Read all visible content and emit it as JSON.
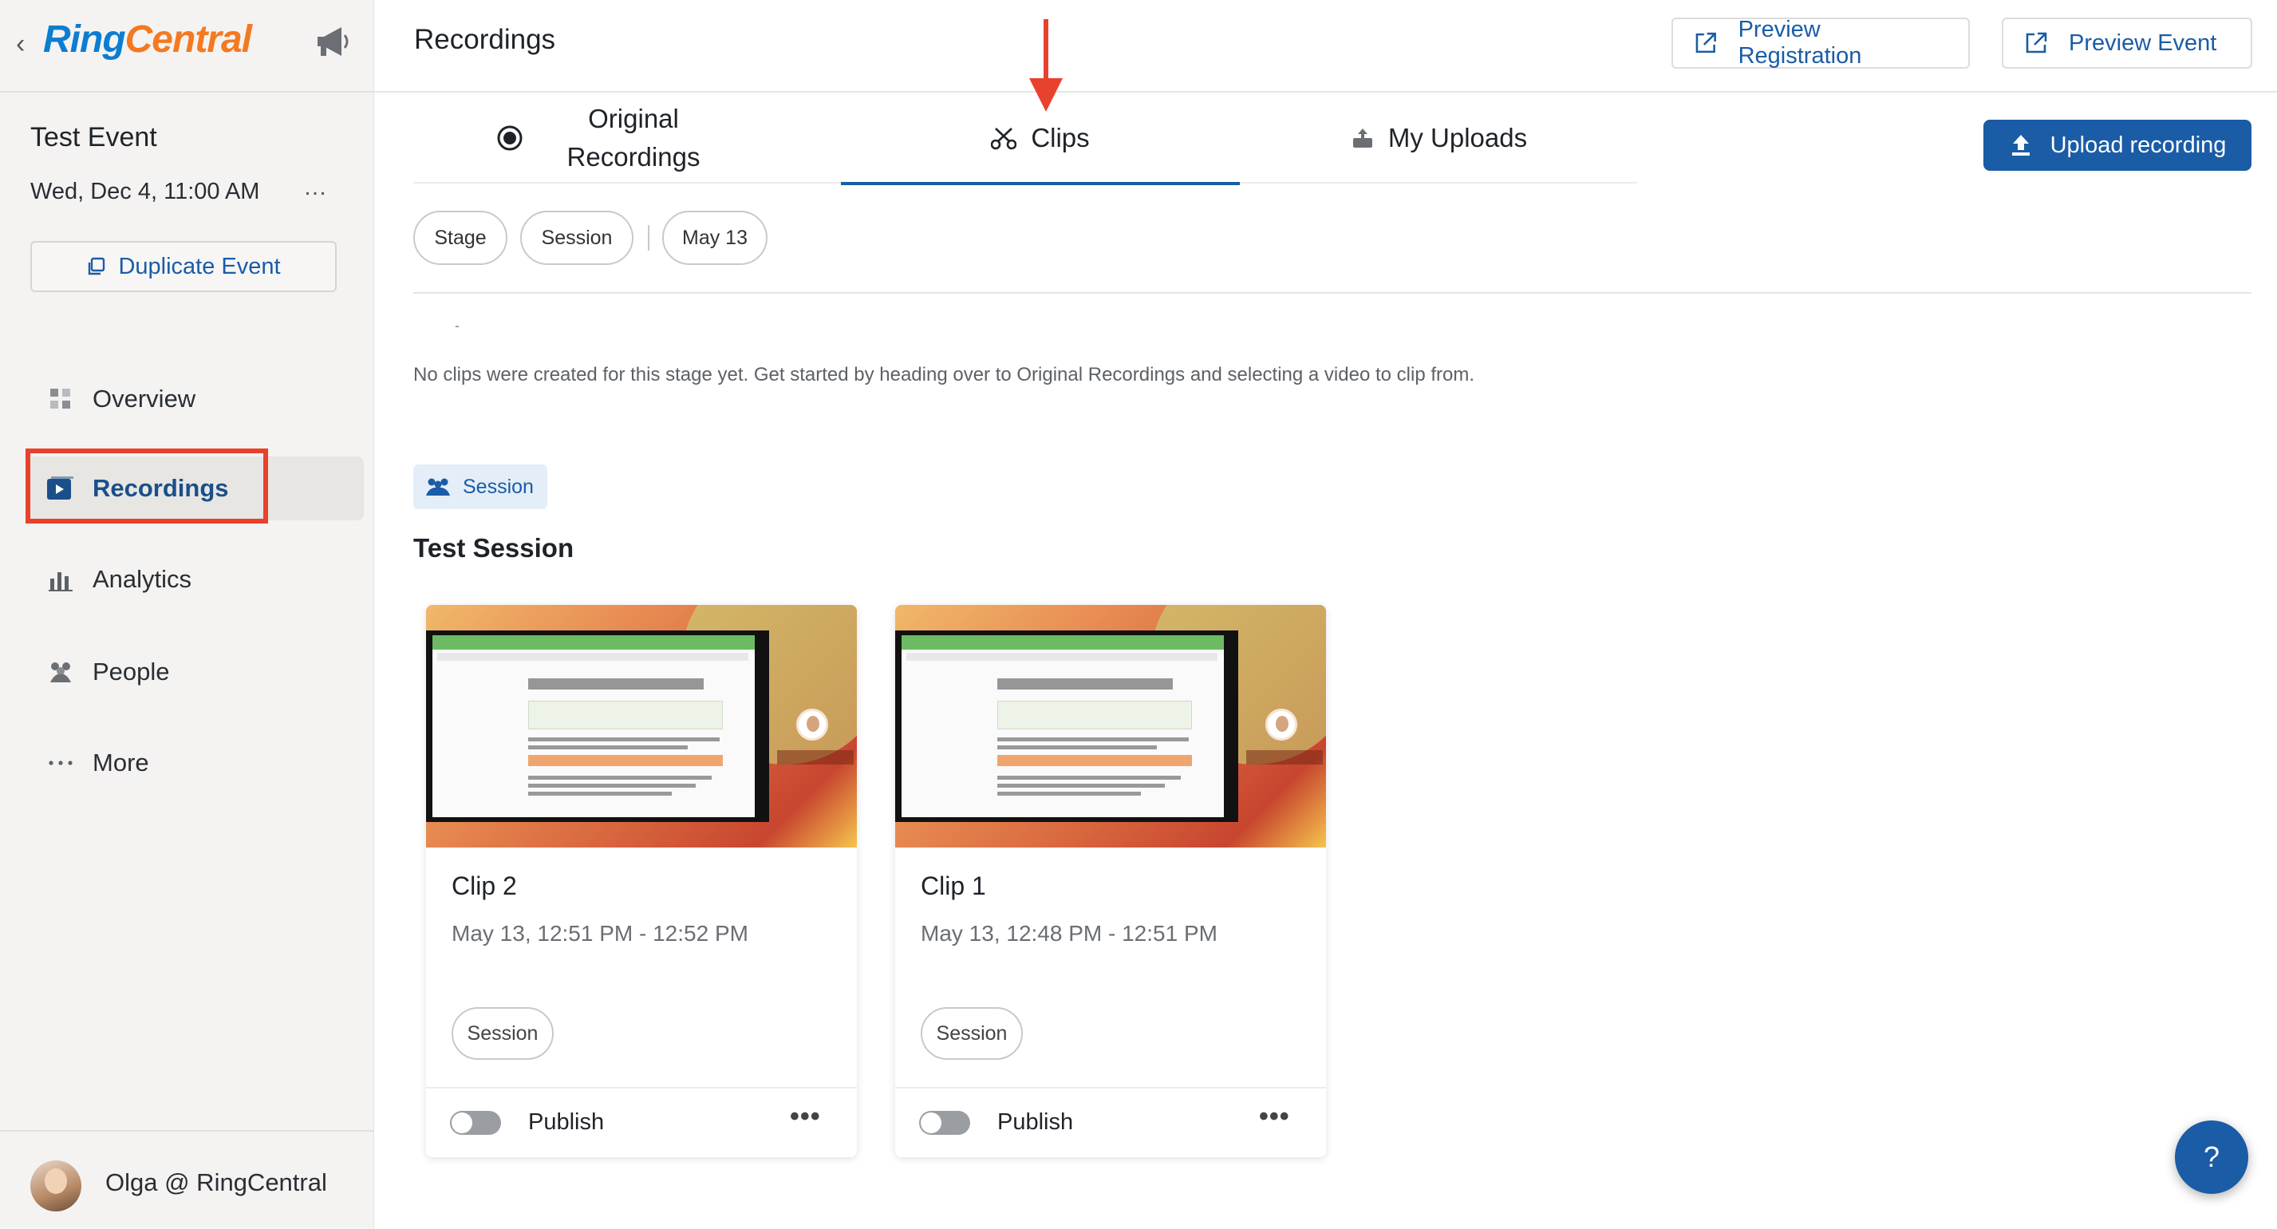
{
  "brand": {
    "ring": "Ring",
    "central": "Central"
  },
  "event": {
    "title": "Test Event",
    "date": "Wed, Dec 4, 11:00 AM",
    "more": "…",
    "duplicate_label": "Duplicate Event"
  },
  "nav": [
    {
      "label": "Overview",
      "icon": "grid-icon"
    },
    {
      "label": "Recordings",
      "icon": "recording-icon",
      "active": true
    },
    {
      "label": "Analytics",
      "icon": "bar-chart-icon"
    },
    {
      "label": "People",
      "icon": "people-icon"
    },
    {
      "label": "More",
      "icon": "dots-icon"
    }
  ],
  "user": {
    "name": "Olga @ RingCentral"
  },
  "header": {
    "title": "Recordings",
    "preview_registration": "Preview Registration",
    "preview_event": "Preview Event"
  },
  "tabs": {
    "original": "Original Recordings",
    "clips": "Clips",
    "uploads": "My Uploads",
    "active": "Clips"
  },
  "upload_button": "Upload recording",
  "filters": {
    "stage": "Stage",
    "session": "Session",
    "date": "May 13"
  },
  "stage_dash": "-",
  "empty_message": "No clips were created for this stage yet. Get started by heading over to Original Recordings and selecting a video to clip from.",
  "session": {
    "tag": "Session",
    "title": "Test Session"
  },
  "clips": [
    {
      "title": "Clip 2",
      "time": "May 13, 12:51 PM - 12:52 PM",
      "chip": "Session",
      "publish": "Publish",
      "more": "•••",
      "published": false
    },
    {
      "title": "Clip 1",
      "time": "May 13, 12:48 PM - 12:51 PM",
      "chip": "Session",
      "publish": "Publish",
      "more": "•••",
      "published": false
    }
  ],
  "help": "?",
  "colors": {
    "accent": "#1a5ca6",
    "highlight": "#e8412c",
    "brand_blue": "#0c7dd1",
    "brand_orange": "#f47920"
  }
}
